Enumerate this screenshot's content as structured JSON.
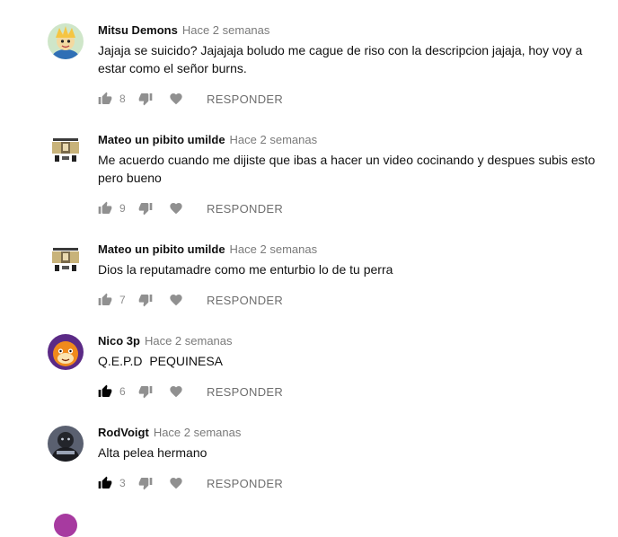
{
  "comments": [
    {
      "author": "Mitsu Demons",
      "time": "Hace 2 semanas",
      "text": "Jajaja se suicido? Jajajaja boludo me cague de riso con la descripcion jajaja, hoy voy a estar como el señor burns.",
      "likes": "8",
      "reply_label": "RESPONDER",
      "avatar": "cartoon-character-avatar",
      "liked": false
    },
    {
      "author": "Mateo un pibito umilde",
      "time": "Hace 2 semanas",
      "text": "Me acuerdo cuando me dijiste que ibas a hacer un video cocinando y despues subis esto pero bueno",
      "likes": "9",
      "reply_label": "RESPONDER",
      "avatar": "pixel-art-avatar",
      "liked": false
    },
    {
      "author": "Mateo un pibito umilde",
      "time": "Hace 2 semanas",
      "text": "Dios la reputamadre como me enturbio lo de tu perra",
      "likes": "7",
      "reply_label": "RESPONDER",
      "avatar": "pixel-art-avatar",
      "liked": false
    },
    {
      "author": "Nico 3p",
      "time": "Hace 2 semanas",
      "text": "Q.E.P.D  PEQUINESA",
      "likes": "6",
      "reply_label": "RESPONDER",
      "avatar": "orange-purple-avatar",
      "liked": true
    },
    {
      "author": "RodVoigt",
      "time": "Hace 2 semanas",
      "text": "Alta pelea hermano",
      "likes": "3",
      "reply_label": "RESPONDER",
      "avatar": "dark-figure-avatar",
      "liked": true
    }
  ],
  "colors": {
    "icon_gray": "#909090",
    "icon_dark": "#030303",
    "time_gray": "#7a7a7a",
    "partial_avatar": "#a73aa0"
  },
  "icons": {
    "like": "thumb-up-icon",
    "dislike": "thumb-down-icon",
    "heart": "heart-icon"
  }
}
